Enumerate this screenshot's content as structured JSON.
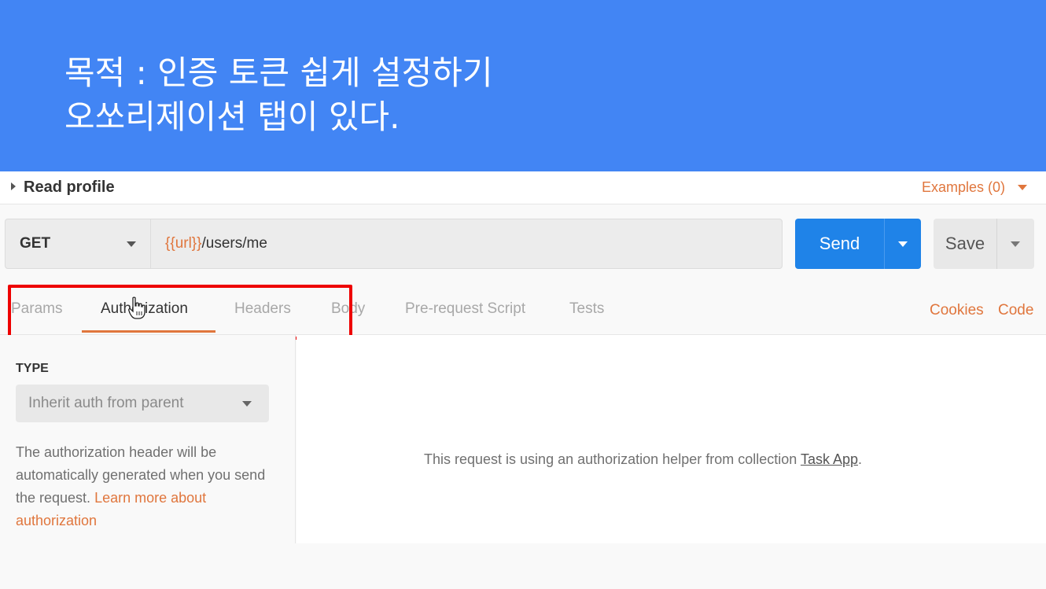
{
  "slide": {
    "line1": "목적 : 인증 토큰 쉽게 설정하기",
    "line2": "오쏘리제이션 탭이 있다."
  },
  "request": {
    "name": "Read profile",
    "examples_label": "Examples (0)",
    "method": "GET",
    "url_variable": "{{url}}",
    "url_path": "/users/me",
    "send_label": "Send",
    "save_label": "Save"
  },
  "tabs": [
    {
      "label": "Params"
    },
    {
      "label": "Authorization"
    },
    {
      "label": "Headers"
    },
    {
      "label": "Body"
    },
    {
      "label": "Pre-request Script"
    },
    {
      "label": "Tests"
    }
  ],
  "right_links": {
    "cookies": "Cookies",
    "code": "Code"
  },
  "auth": {
    "type_label": "TYPE",
    "type_value": "Inherit auth from parent",
    "description": "The authorization header will be automatically generated when you send the request. ",
    "learn_more": "Learn more about authorization",
    "helper_text": "This request is using an authorization helper from collection ",
    "collection_link": "Task App",
    "helper_suffix": "."
  },
  "colors": {
    "banner": "#4285f4",
    "accent": "#e0763d",
    "send": "#1f83e8",
    "highlight": "#ee0000"
  },
  "icons": {
    "title_caret": "caret-right-icon",
    "examples_caret": "caret-down-icon",
    "cursor": "hand-pointer-icon"
  }
}
